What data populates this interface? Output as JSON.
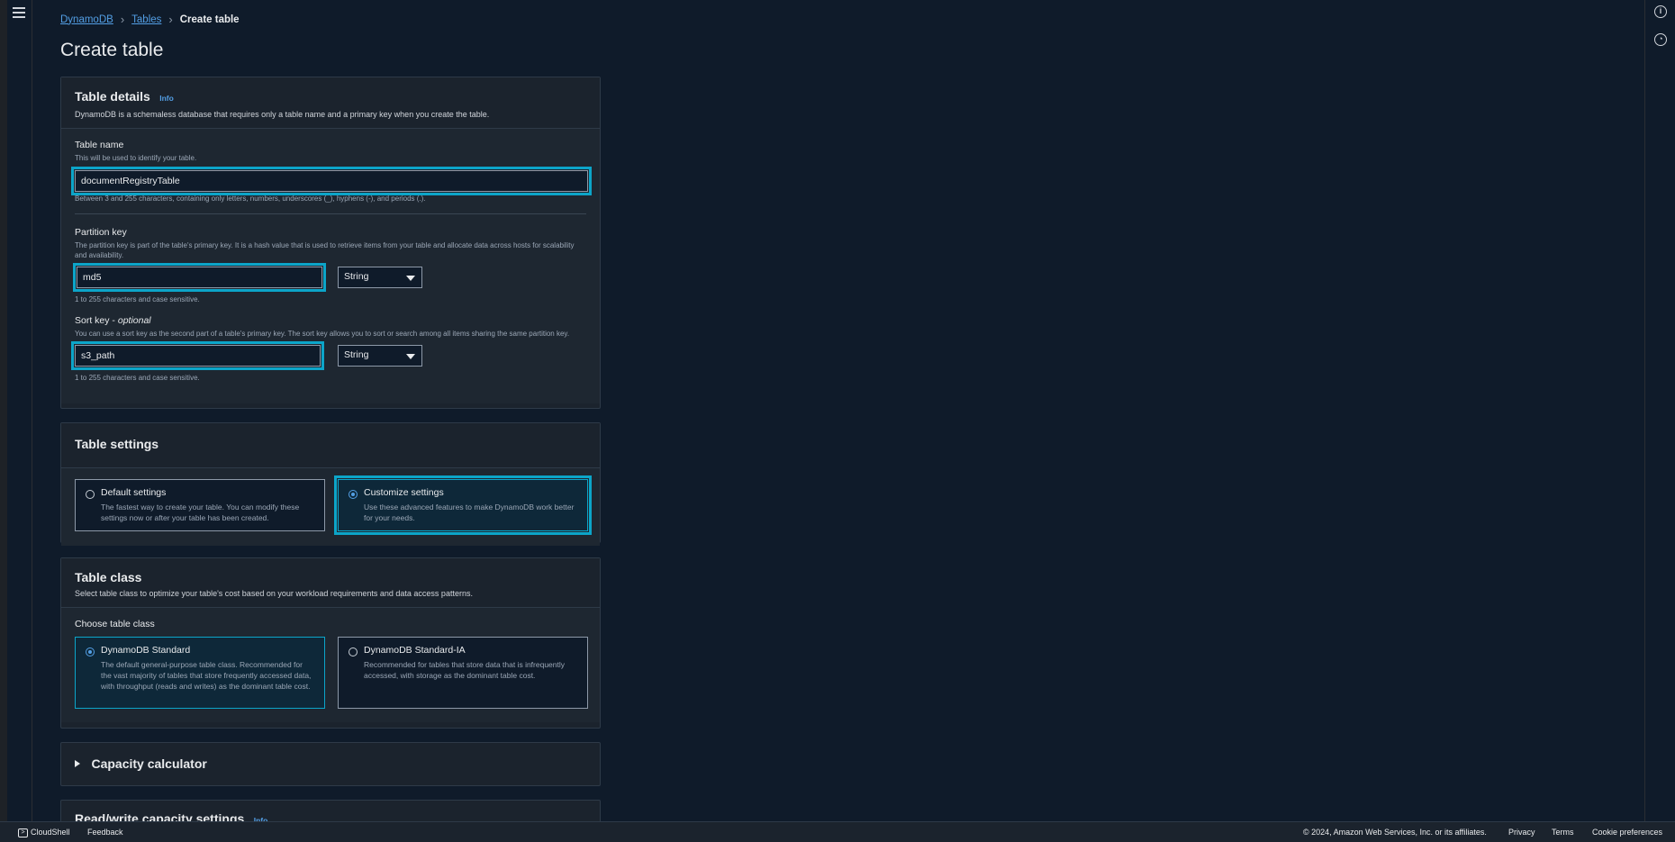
{
  "breadcrumb": {
    "root": "DynamoDB",
    "tables": "Tables",
    "current": "Create table"
  },
  "page_title": "Create table",
  "table_details": {
    "title": "Table details",
    "info": "Info",
    "desc": "DynamoDB is a schemaless database that requires only a table name and a primary key when you create the table.",
    "table_name_label": "Table name",
    "table_name_desc": "This will be used to identify your table.",
    "table_name_value": "documentRegistryTable",
    "table_name_hint": "Between 3 and 255 characters, containing only letters, numbers, underscores (_), hyphens (-), and periods (.).",
    "partition_label": "Partition key",
    "partition_desc": "The partition key is part of the table's primary key. It is a hash value that is used to retrieve items from your table and allocate data across hosts for scalability and availability.",
    "partition_value": "md5",
    "partition_type": "String",
    "partition_hint": "1 to 255 characters and case sensitive.",
    "sort_label": "Sort key -",
    "sort_optional": "optional",
    "sort_desc": "You can use a sort key as the second part of a table's primary key. The sort key allows you to sort or search among all items sharing the same partition key.",
    "sort_value": "s3_path",
    "sort_type": "String",
    "sort_hint": "1 to 255 characters and case sensitive."
  },
  "table_settings": {
    "title": "Table settings",
    "default_title": "Default settings",
    "default_desc": "The fastest way to create your table. You can modify these settings now or after your table has been created.",
    "custom_title": "Customize settings",
    "custom_desc": "Use these advanced features to make DynamoDB work better for your needs."
  },
  "table_class": {
    "title": "Table class",
    "desc": "Select table class to optimize your table's cost based on your workload requirements and data access patterns.",
    "choose_label": "Choose table class",
    "standard_title": "DynamoDB Standard",
    "standard_desc": "The default general-purpose table class. Recommended for the vast majority of tables that store frequently accessed data, with throughput (reads and writes) as the dominant table cost.",
    "ia_title": "DynamoDB Standard-IA",
    "ia_desc": "Recommended for tables that store data that is infrequently accessed, with storage as the dominant table cost."
  },
  "capacity_calculator": {
    "title": "Capacity calculator"
  },
  "rw_capacity": {
    "title": "Read/write capacity settings",
    "info": "Info"
  },
  "footer": {
    "cloudshell": "CloudShell",
    "feedback": "Feedback",
    "copyright": "© 2024, Amazon Web Services, Inc. or its affiliates.",
    "privacy": "Privacy",
    "terms": "Terms",
    "cookie": "Cookie preferences"
  },
  "colors": {
    "accent": "#0ca5c9",
    "link": "#539fe5",
    "background": "#0f1b2a"
  }
}
